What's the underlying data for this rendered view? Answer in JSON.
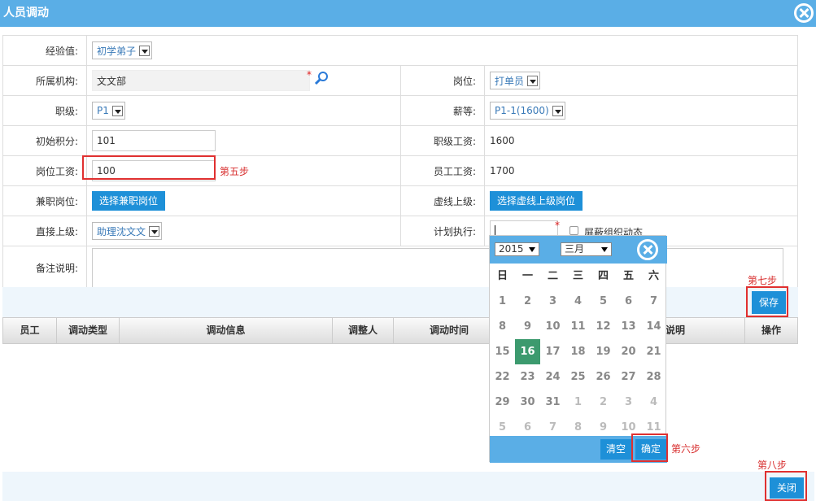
{
  "window": {
    "title": "人员调动"
  },
  "form": {
    "exp_label": "经验值:",
    "exp_value": "初学弟子",
    "org_label": "所属机构:",
    "org_value": "文文部",
    "post_label": "岗位:",
    "post_value": "打单员",
    "rank_label": "职级:",
    "rank_value": "P1",
    "grade_label": "薪等:",
    "grade_value": "P1-1(1600)",
    "init_label": "初始积分:",
    "init_value": "101",
    "rankpay_label": "职级工资:",
    "rankpay_value": "1600",
    "postpay_label": "岗位工资:",
    "postpay_value": "100",
    "emppay_label": "员工工资:",
    "emppay_value": "1700",
    "parttime_label": "兼职岗位:",
    "parttime_btn": "选择兼职岗位",
    "virtual_label": "虚线上级:",
    "virtual_btn": "选择虚线上级岗位",
    "direct_label": "直接上级:",
    "direct_value": "助理沈文文",
    "plan_label": "计划执行:",
    "mask_label": "屏蔽组织动态",
    "remark_label": "备注说明:",
    "required": "*"
  },
  "steps": {
    "s5": "第五步",
    "s6": "第六步",
    "s7": "第七步",
    "s8": "第八步"
  },
  "buttons": {
    "save": "保存",
    "close": "关闭"
  },
  "list": {
    "headers": [
      "员工",
      "调动类型",
      "调动信息",
      "调整人",
      "调动时间",
      "说明",
      "操作"
    ]
  },
  "calendar": {
    "year": "2015",
    "month": "三月",
    "weekdays": [
      "日",
      "一",
      "二",
      "三",
      "四",
      "五",
      "六"
    ],
    "days": [
      "1",
      "2",
      "3",
      "4",
      "5",
      "6",
      "7",
      "8",
      "9",
      "10",
      "11",
      "12",
      "13",
      "14",
      "15",
      "16",
      "17",
      "18",
      "19",
      "20",
      "21",
      "22",
      "23",
      "24",
      "25",
      "26",
      "27",
      "28",
      "29",
      "30",
      "31",
      "1",
      "2",
      "3",
      "4",
      "5",
      "6",
      "7",
      "8",
      "9",
      "10",
      "11"
    ],
    "today": "16",
    "clear": "清空",
    "ok": "确定"
  },
  "colors": {
    "accent": "#5aaee6",
    "button": "#1e90d8",
    "highlight": "#e03030",
    "today": "#3c9a6e"
  }
}
